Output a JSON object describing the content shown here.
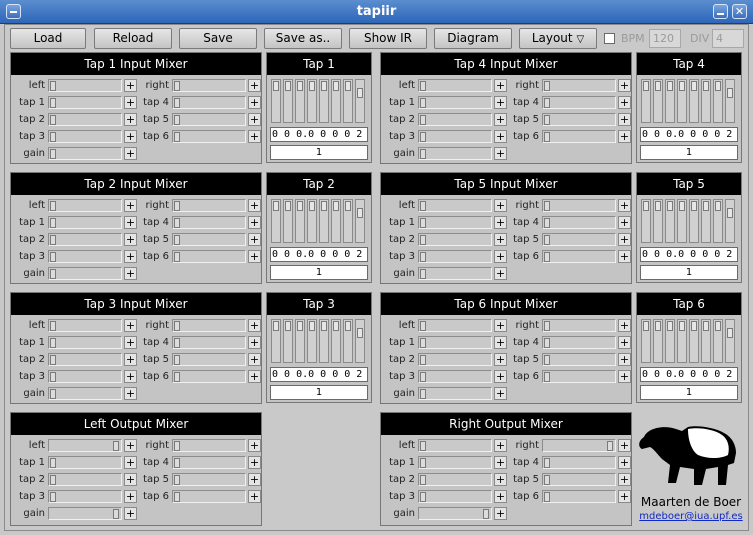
{
  "window": {
    "title": "tapiir"
  },
  "toolbar": {
    "load": "Load",
    "reload": "Reload",
    "save": "Save",
    "save_as": "Save as..",
    "show_ir": "Show IR",
    "diagram": "Diagram",
    "layout": "Layout",
    "layout_arrow": "▽",
    "bpm_label": "BPM",
    "bpm_value": "120",
    "div_label": "DIV",
    "div_value": "4"
  },
  "glyph_plus": "+",
  "input_mixers": [
    {
      "title": "Tap 1 Input Mixer",
      "left": [
        "left",
        "tap 1",
        "tap 2",
        "tap 3",
        "gain"
      ],
      "right": [
        "right",
        "tap 4",
        "tap 5",
        "tap 6"
      ]
    },
    {
      "title": "Tap 4 Input Mixer",
      "left": [
        "left",
        "tap 1",
        "tap 2",
        "tap 3",
        "gain"
      ],
      "right": [
        "right",
        "tap 4",
        "tap 5",
        "tap 6"
      ]
    },
    {
      "title": "Tap 2 Input Mixer",
      "left": [
        "left",
        "tap 1",
        "tap 2",
        "tap 3",
        "gain"
      ],
      "right": [
        "right",
        "tap 4",
        "tap 5",
        "tap 6"
      ]
    },
    {
      "title": "Tap 5 Input Mixer",
      "left": [
        "left",
        "tap 1",
        "tap 2",
        "tap 3",
        "gain"
      ],
      "right": [
        "right",
        "tap 4",
        "tap 5",
        "tap 6"
      ]
    },
    {
      "title": "Tap 3 Input Mixer",
      "left": [
        "left",
        "tap 1",
        "tap 2",
        "tap 3",
        "gain"
      ],
      "right": [
        "right",
        "tap 4",
        "tap 5",
        "tap 6"
      ]
    },
    {
      "title": "Tap 6 Input Mixer",
      "left": [
        "left",
        "tap 1",
        "tap 2",
        "tap 3",
        "gain"
      ],
      "right": [
        "right",
        "tap 4",
        "tap 5",
        "tap 6"
      ]
    }
  ],
  "output_mixers": [
    {
      "title": "Left Output Mixer",
      "left": [
        "left",
        "tap 1",
        "tap 2",
        "tap 3",
        "gain"
      ],
      "right": [
        "right",
        "tap 4",
        "tap 5",
        "tap 6"
      ]
    },
    {
      "title": "Right Output Mixer",
      "left": [
        "left",
        "tap 1",
        "tap 2",
        "tap 3",
        "gain"
      ],
      "right": [
        "right",
        "tap 4",
        "tap 5",
        "tap 6"
      ]
    }
  ],
  "taps": [
    {
      "title": "Tap 1",
      "value": "0 0 0.0 0 0 0 2",
      "number": "1"
    },
    {
      "title": "Tap 4",
      "value": "0 0 0.0 0 0 0 2",
      "number": "1"
    },
    {
      "title": "Tap 2",
      "value": "0 0 0.0 0 0 0 2",
      "number": "1"
    },
    {
      "title": "Tap 5",
      "value": "0 0 0.0 0 0 0 2",
      "number": "1"
    },
    {
      "title": "Tap 3",
      "value": "0 0 0.0 0 0 0 2",
      "number": "1"
    },
    {
      "title": "Tap 6",
      "value": "0 0 0.0 0 0 0 2",
      "number": "1"
    }
  ],
  "credit": {
    "author": "Maarten de Boer",
    "email": "mdeboer@iua.upf.es",
    "logo": "tapir-icon"
  }
}
